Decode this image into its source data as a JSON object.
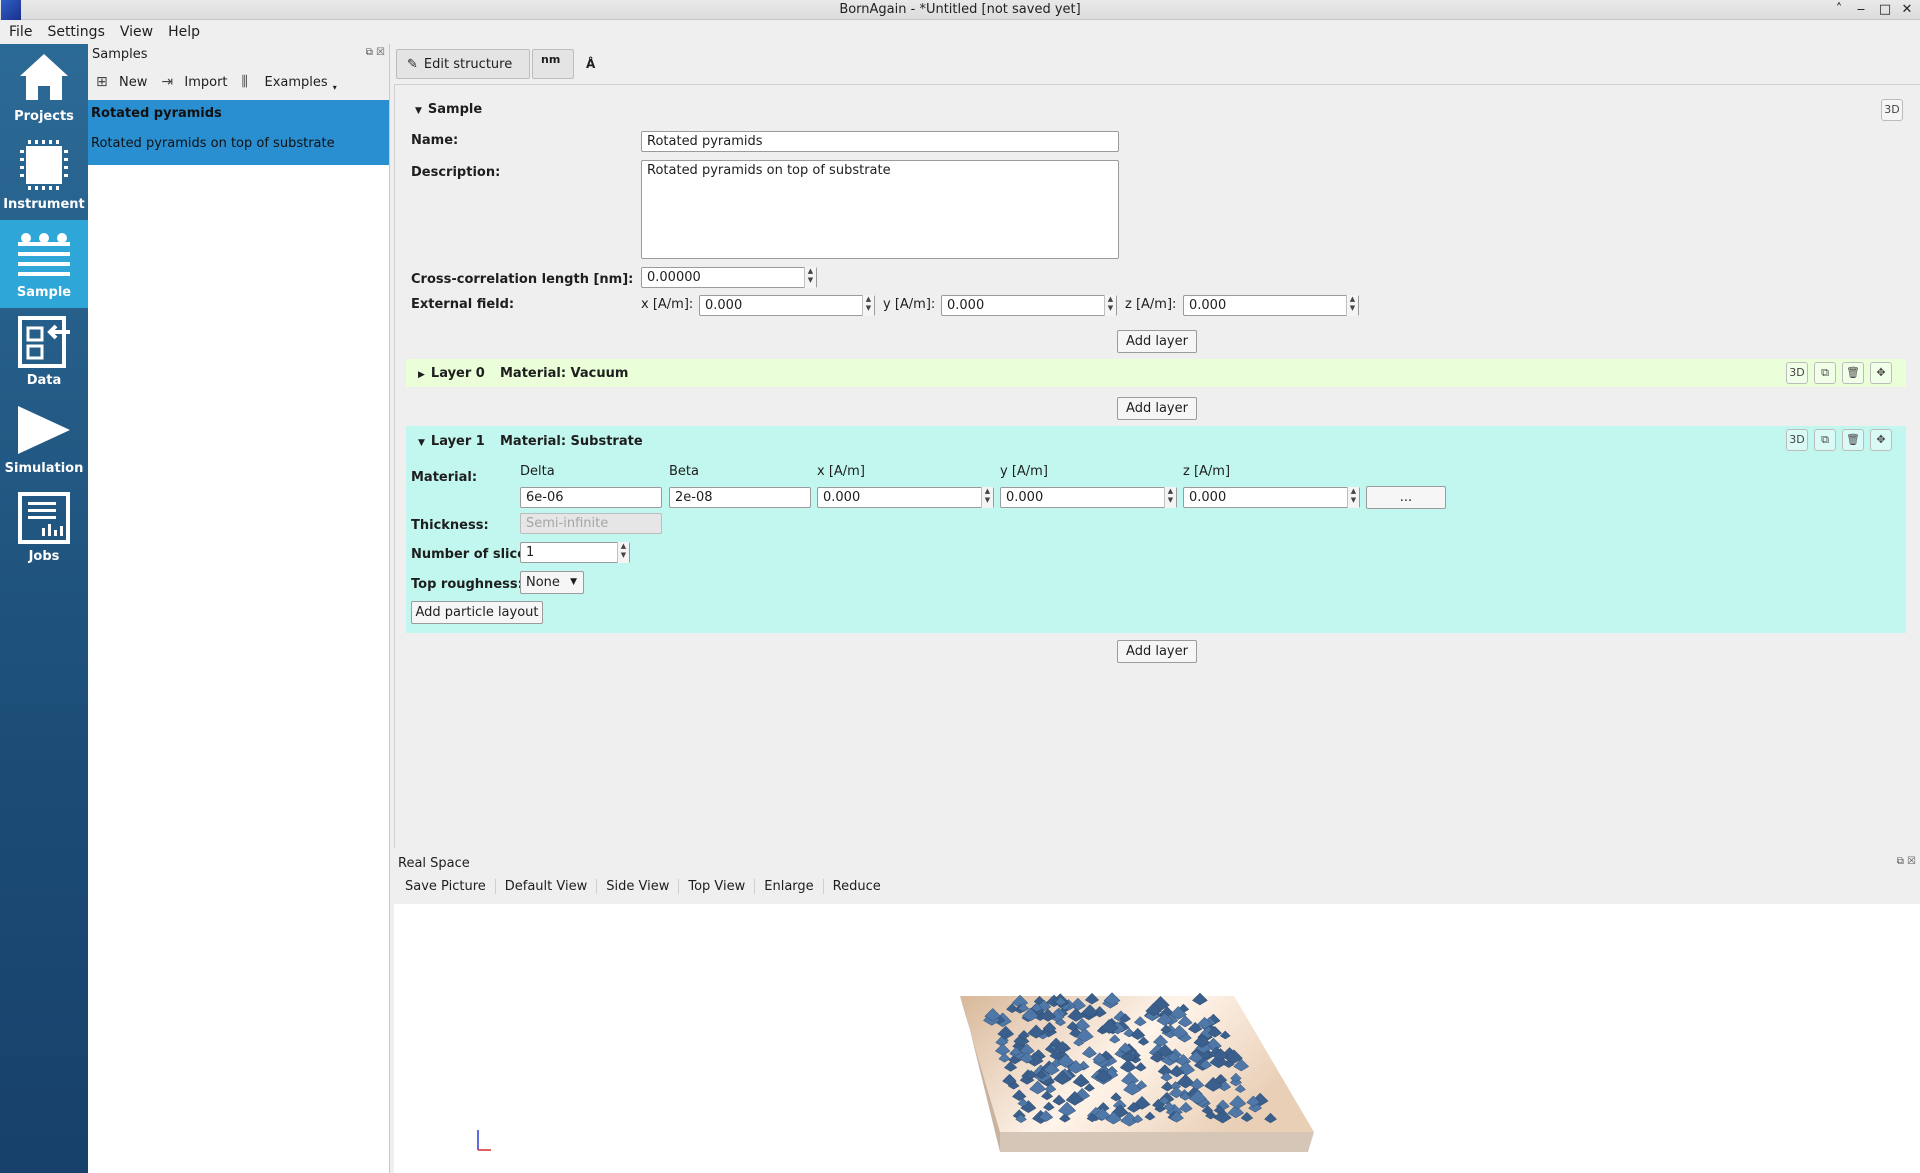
{
  "window": {
    "title": "BornAgain - *Untitled [not saved yet]"
  },
  "menubar": [
    "File",
    "Settings",
    "View",
    "Help"
  ],
  "nav": [
    {
      "label": "Projects",
      "icon": "house-icon"
    },
    {
      "label": "Instrument",
      "icon": "chip-icon"
    },
    {
      "label": "Sample",
      "icon": "layers-icon",
      "active": true
    },
    {
      "label": "Data",
      "icon": "data-import-icon"
    },
    {
      "label": "Simulation",
      "icon": "play-icon"
    },
    {
      "label": "Jobs",
      "icon": "jobs-chart-icon"
    }
  ],
  "samples_panel": {
    "title": "Samples",
    "toolbar": {
      "new": "New",
      "import": "Import",
      "examples": "Examples"
    },
    "items": [
      {
        "name": "Rotated pyramids",
        "description": "Rotated pyramids on top of substrate"
      }
    ]
  },
  "editor_toolbar": {
    "edit_structure": "Edit structure",
    "unit": "nm",
    "angstrom": "Å"
  },
  "sample": {
    "header": "Sample",
    "name_label": "Name:",
    "name_value": "Rotated pyramids",
    "description_label": "Description:",
    "description_value": "Rotated pyramids on top of substrate",
    "cross_corr_label": "Cross-correlation length [nm]:",
    "cross_corr_value": "0.00000",
    "external_field_label": "External field:",
    "field_x_label": "x [A/m]:",
    "field_x_value": "0.000",
    "field_y_label": "y [A/m]:",
    "field_y_value": "0.000",
    "field_z_label": "z [A/m]:",
    "field_z_value": "0.000"
  },
  "add_layer_label": "Add layer",
  "layer0": {
    "title": "Layer 0",
    "material": "Material: Vacuum",
    "color": "#eaffd9"
  },
  "layer1": {
    "title": "Layer 1",
    "material": "Material: Substrate",
    "color": "#c1f7ee",
    "material_label": "Material:",
    "col_delta": "Delta",
    "col_beta": "Beta",
    "col_x": "x [A/m]",
    "col_y": "y [A/m]",
    "col_z": "z [A/m]",
    "delta_value": "6e-06",
    "beta_value": "2e-08",
    "x_value": "0.000",
    "y_value": "0.000",
    "z_value": "0.000",
    "more_button": "...",
    "thickness_label": "Thickness:",
    "thickness_placeholder": "Semi-infinite",
    "slices_label": "Number of slices:",
    "slices_value": "1",
    "roughness_label": "Top roughness:",
    "roughness_value": "None",
    "add_particle_layout": "Add particle layout"
  },
  "realspace": {
    "title": "Real Space",
    "buttons": [
      "Save Picture",
      "Default View",
      "Side View",
      "Top View",
      "Enlarge",
      "Reduce"
    ]
  }
}
